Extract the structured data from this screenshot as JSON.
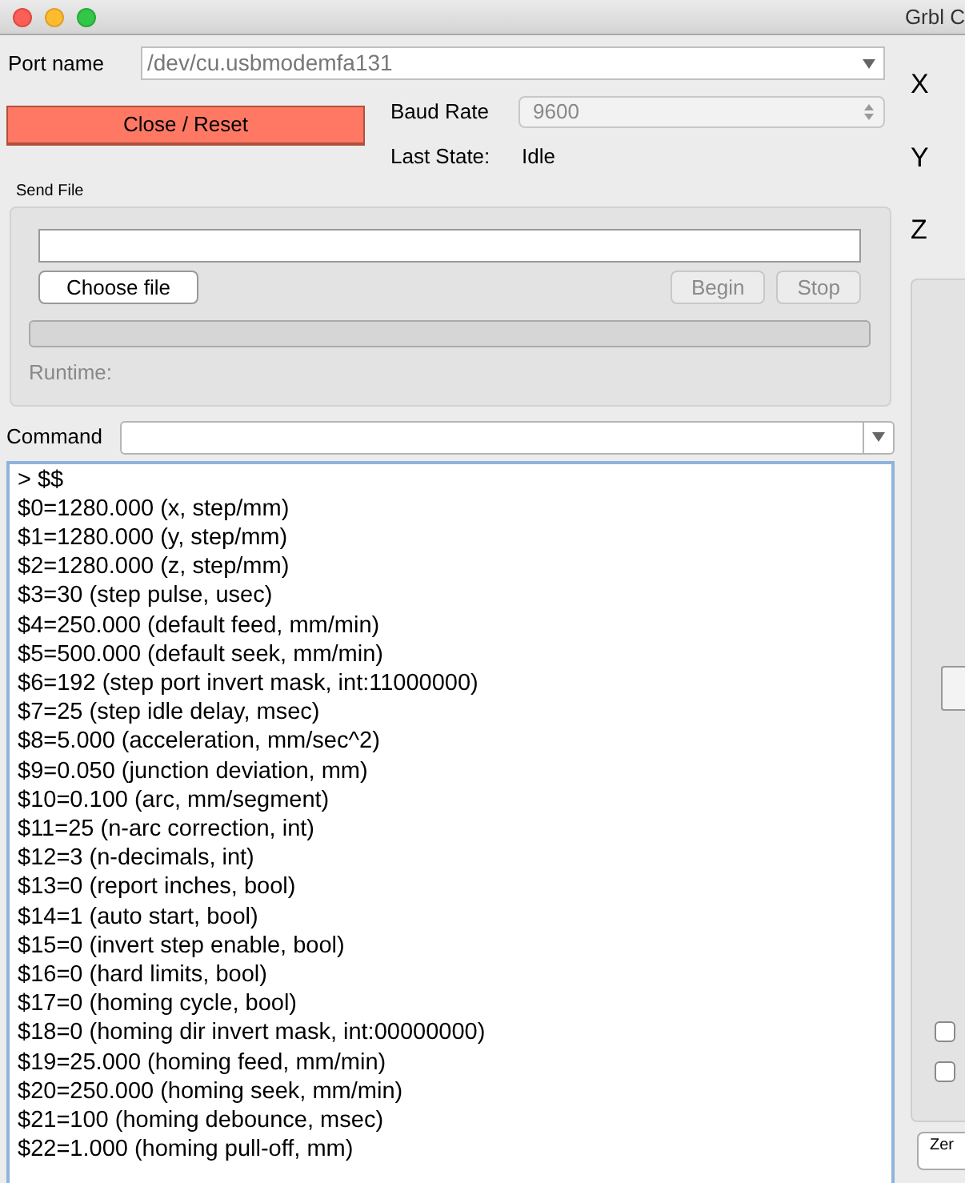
{
  "window": {
    "title": "Grbl C"
  },
  "port": {
    "label": "Port name",
    "value": "/dev/cu.usbmodemfa131"
  },
  "close_button": "Close / Reset",
  "baud": {
    "label": "Baud Rate",
    "value": "9600"
  },
  "last_state": {
    "label": "Last State:",
    "value": "Idle"
  },
  "send_file": {
    "title": "Send File",
    "choose_button": "Choose file",
    "begin_button": {
      "label": "Begin",
      "disabled": true
    },
    "stop_button": {
      "label": "Stop",
      "disabled": true
    },
    "progress": {
      "level": 0
    },
    "runtime_label": "Runtime:"
  },
  "command": {
    "label": "Command"
  },
  "console_lines": [
    "> $$",
    "$0=1280.000 (x, step/mm)",
    "$1=1280.000 (y, step/mm)",
    "$2=1280.000 (z, step/mm)",
    "$3=30 (step pulse, usec)",
    "$4=250.000 (default feed, mm/min)",
    "$5=500.000 (default seek, mm/min)",
    "$6=192 (step port invert mask, int:11000000)",
    "$7=25 (step idle delay, msec)",
    "$8=5.000 (acceleration, mm/sec^2)",
    "$9=0.050 (junction deviation, mm)",
    "$10=0.100 (arc, mm/segment)",
    "$11=25 (n-arc correction, int)",
    "$12=3 (n-decimals, int)",
    "$13=0 (report inches, bool)",
    "$14=1 (auto start, bool)",
    "$15=0 (invert step enable, bool)",
    "$16=0 (hard limits, bool)",
    "$17=0 (homing cycle, bool)",
    "$18=0 (homing dir invert mask, int:00000000)",
    "$19=25.000 (homing feed, mm/min)",
    "$20=250.000 (homing seek, mm/min)",
    "$21=100 (homing debounce, msec)",
    "$22=1.000 (homing pull-off, mm)"
  ],
  "axes": [
    "X",
    "Y",
    "Z"
  ],
  "side_checkboxes": [
    {
      "checked": false
    },
    {
      "checked": false
    }
  ],
  "zero_button": "Zer"
}
